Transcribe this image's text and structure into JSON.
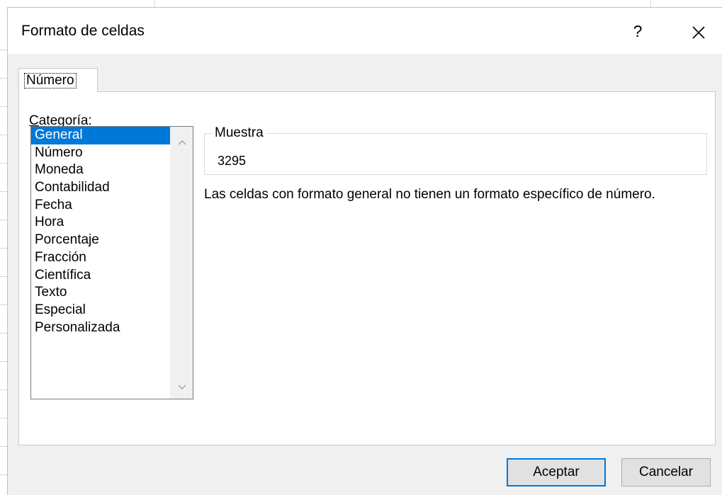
{
  "dialog": {
    "title": "Formato de celdas",
    "help_label": "?",
    "close_icon": "close-icon"
  },
  "tabs": [
    {
      "label": "Número",
      "active": true
    }
  ],
  "category": {
    "label_first": "C",
    "label_rest": "ategoría:",
    "items": [
      "General",
      "Número",
      "Moneda",
      "Contabilidad",
      "Fecha",
      "Hora",
      "Porcentaje",
      "Fracción",
      "Científica",
      "Texto",
      "Especial",
      "Personalizada"
    ],
    "selected": "General"
  },
  "sample": {
    "legend": "Muestra",
    "value": "3295"
  },
  "description": "Las celdas con formato general no tienen un formato específico de número.",
  "buttons": {
    "ok": "Aceptar",
    "cancel": "Cancelar"
  },
  "colors": {
    "selection": "#0078d7",
    "dialog_bg": "#f0f0f0",
    "panel_bg": "#ffffff",
    "default_button_border": "#0078d7"
  }
}
